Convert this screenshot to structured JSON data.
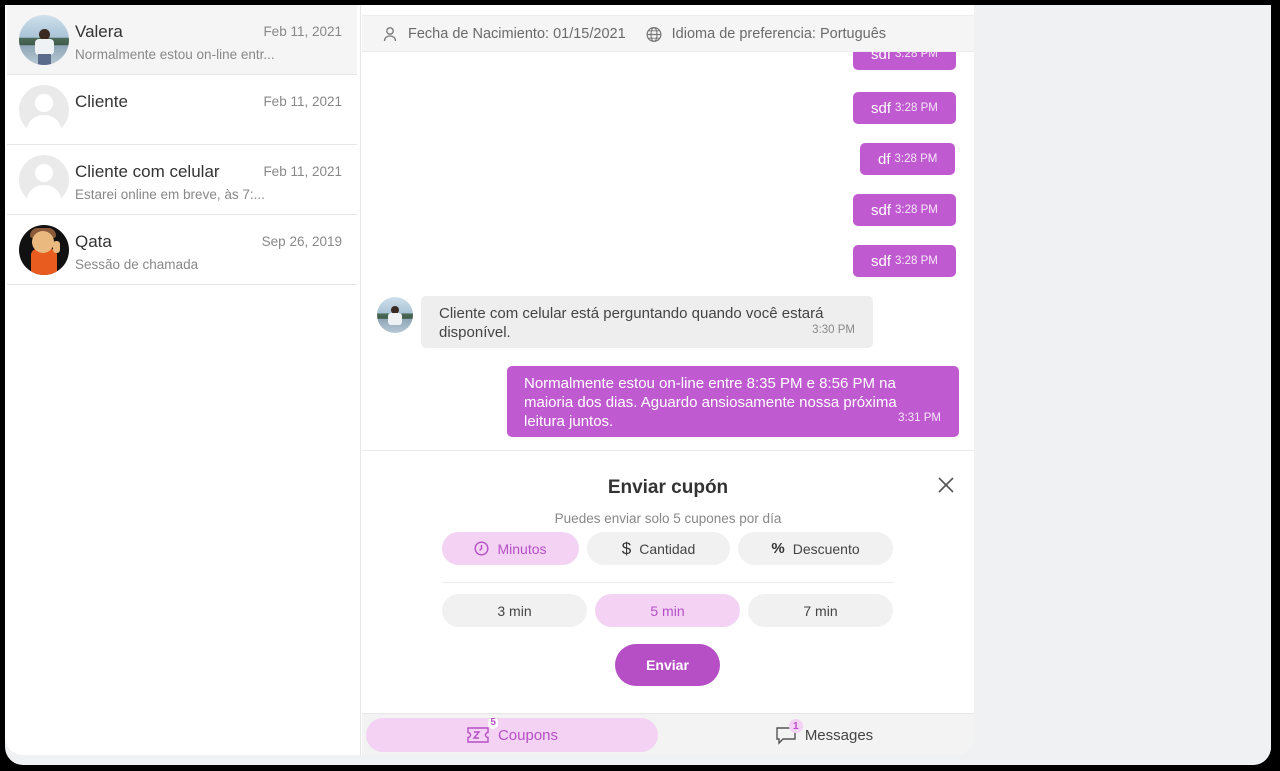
{
  "conversations": [
    {
      "name": "Valera",
      "date": "Feb 11, 2021",
      "preview": "Normalmente estou on-line entr..."
    },
    {
      "name": "Cliente",
      "date": "Feb 11, 2021",
      "preview": ""
    },
    {
      "name": "Cliente com celular",
      "date": "Feb 11, 2021",
      "preview": "Estarei online em breve, às 7:..."
    },
    {
      "name": "Qata",
      "date": "Sep 26, 2019",
      "preview": "Sessão de chamada"
    }
  ],
  "info_bar": {
    "birthdate": "Fecha de Nacimiento: 01/15/2021",
    "language": "Idioma de preferencia: Português"
  },
  "messages": [
    {
      "text": "sdf",
      "time": "3:28 PM"
    },
    {
      "text": "sdf",
      "time": "3:28 PM"
    },
    {
      "text": "df",
      "time": "3:28 PM"
    },
    {
      "text": "sdf",
      "time": "3:28 PM"
    },
    {
      "text": "sdf",
      "time": "3:28 PM"
    },
    {
      "text": "Cliente com celular está perguntando quando você estará disponível.",
      "time": "3:30 PM"
    },
    {
      "text": "Normalmente estou on-line entre 8:35 PM e 8:56 PM na maioria dos dias. Aguardo ansiosamente nossa próxima leitura juntos.",
      "time": "3:31 PM"
    }
  ],
  "coupon": {
    "title": "Enviar cupón",
    "subtitle": "Puedes enviar solo 5 cupones por día",
    "types": [
      "Minutos",
      "Cantidad",
      "Descuento"
    ],
    "selected_type": "Minutos",
    "durations": [
      "3 min",
      "5 min",
      "7 min"
    ],
    "selected_duration": "5 min",
    "send_label": "Enviar"
  },
  "bottom_nav": {
    "coupons_label": "Coupons",
    "coupons_badge": "5",
    "messages_label": "Messages",
    "messages_badge": "1"
  },
  "colors": {
    "accent": "#c05ad0",
    "accent_light": "#f3d2f4"
  }
}
